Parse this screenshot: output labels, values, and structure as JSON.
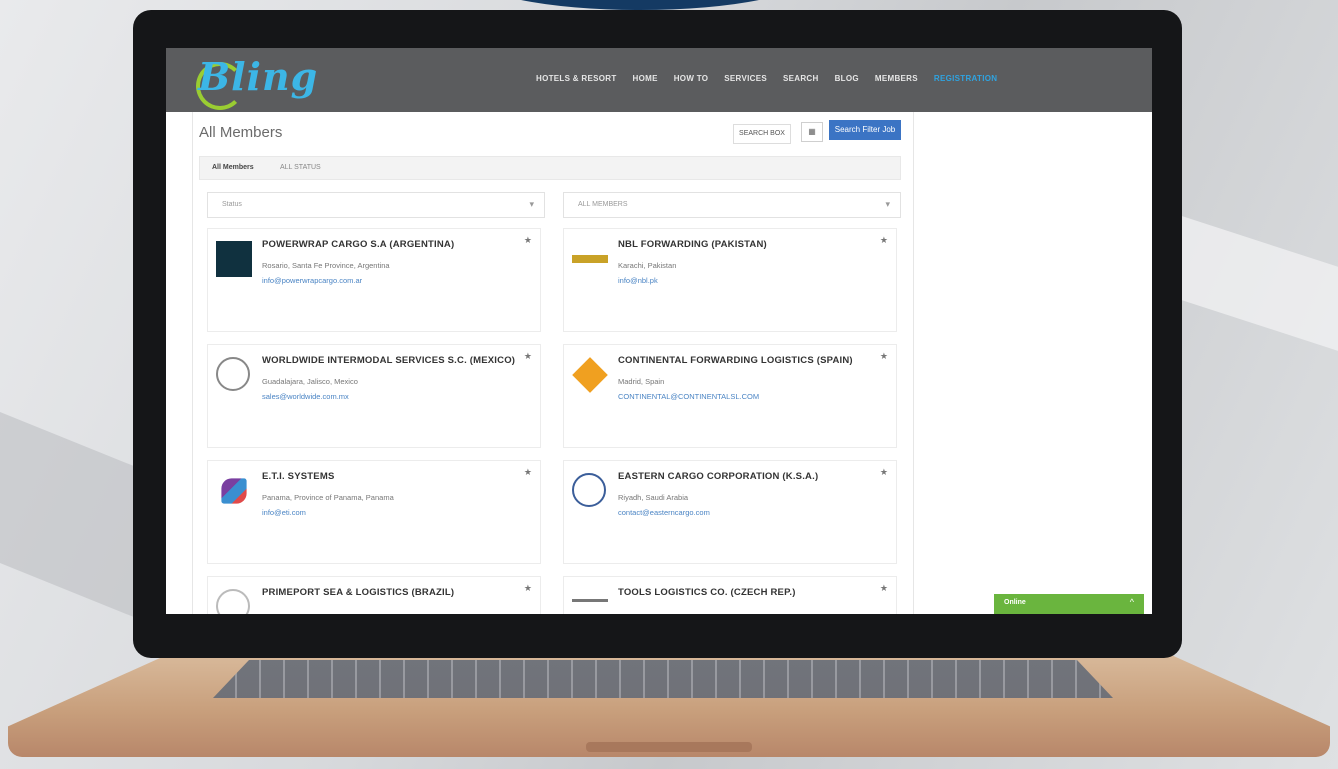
{
  "app": {
    "logo_text": "Bling"
  },
  "nav": {
    "items": [
      {
        "label": "HOTELS & RESORT"
      },
      {
        "label": "HOME"
      },
      {
        "label": "HOW TO"
      },
      {
        "label": "SERVICES"
      },
      {
        "label": "SEARCH"
      },
      {
        "label": "BLOG"
      },
      {
        "label": "MEMBERS"
      },
      {
        "label": "REGISTRATION",
        "active": true
      }
    ]
  },
  "page": {
    "title": "All Members",
    "search_button": "SEARCH BOX",
    "grid_icon": "grid-icon",
    "add_button": "Search Filter Job"
  },
  "subbar": {
    "tab": "All Members",
    "filter": "ALL STATUS"
  },
  "filters": {
    "left": "Status",
    "right": "ALL MEMBERS"
  },
  "members": [
    {
      "name": "POWERWRAP CARGO S.A (ARGENTINA)",
      "tag": "Rosario, Santa Fe Province, Argentina",
      "email": "info@powerwrapcargo.com.ar",
      "logo": "dark-square"
    },
    {
      "name": "NBL FORWARDING (PAKISTAN)",
      "tag": "Karachi, Pakistan",
      "email": "info@nbl.pk",
      "logo": "gold-bar"
    },
    {
      "name": "WORLDWIDE INTERMODAL SERVICES S.C. (MEXICO)",
      "tag": "Guadalajara, Jalisco, Mexico",
      "email": "sales@worldwide.com.mx",
      "logo": "ring"
    },
    {
      "name": "CONTINENTAL FORWARDING LOGISTICS (SPAIN)",
      "tag": "Madrid, Spain",
      "email": "CONTINENTAL@CONTINENTALSL.COM",
      "logo": "orange-diamond"
    },
    {
      "name": "E.T.I. SYSTEMS",
      "tag": "Panama, Province of Panama, Panama",
      "email": "info@eti.com",
      "logo": "figure"
    },
    {
      "name": "EASTERN CARGO CORPORATION (K.S.A.)",
      "tag": "Riyadh, Saudi Arabia",
      "email": "contact@easterncargo.com",
      "logo": "crest"
    },
    {
      "name": "PRIMEPORT SEA & LOGISTICS (BRAZIL)",
      "tag": "",
      "email": "",
      "logo": "circle"
    },
    {
      "name": "TOOLS LOGISTICS CO. (CZECH REP.)",
      "tag": "",
      "email": "",
      "logo": "line"
    }
  ],
  "chat": {
    "label": "Online",
    "chevron": "^"
  },
  "colors": {
    "nav_bg": "#5b5c5e",
    "accent": "#3b74c4",
    "chat": "#6ab53e",
    "link": "#4a84c4"
  }
}
